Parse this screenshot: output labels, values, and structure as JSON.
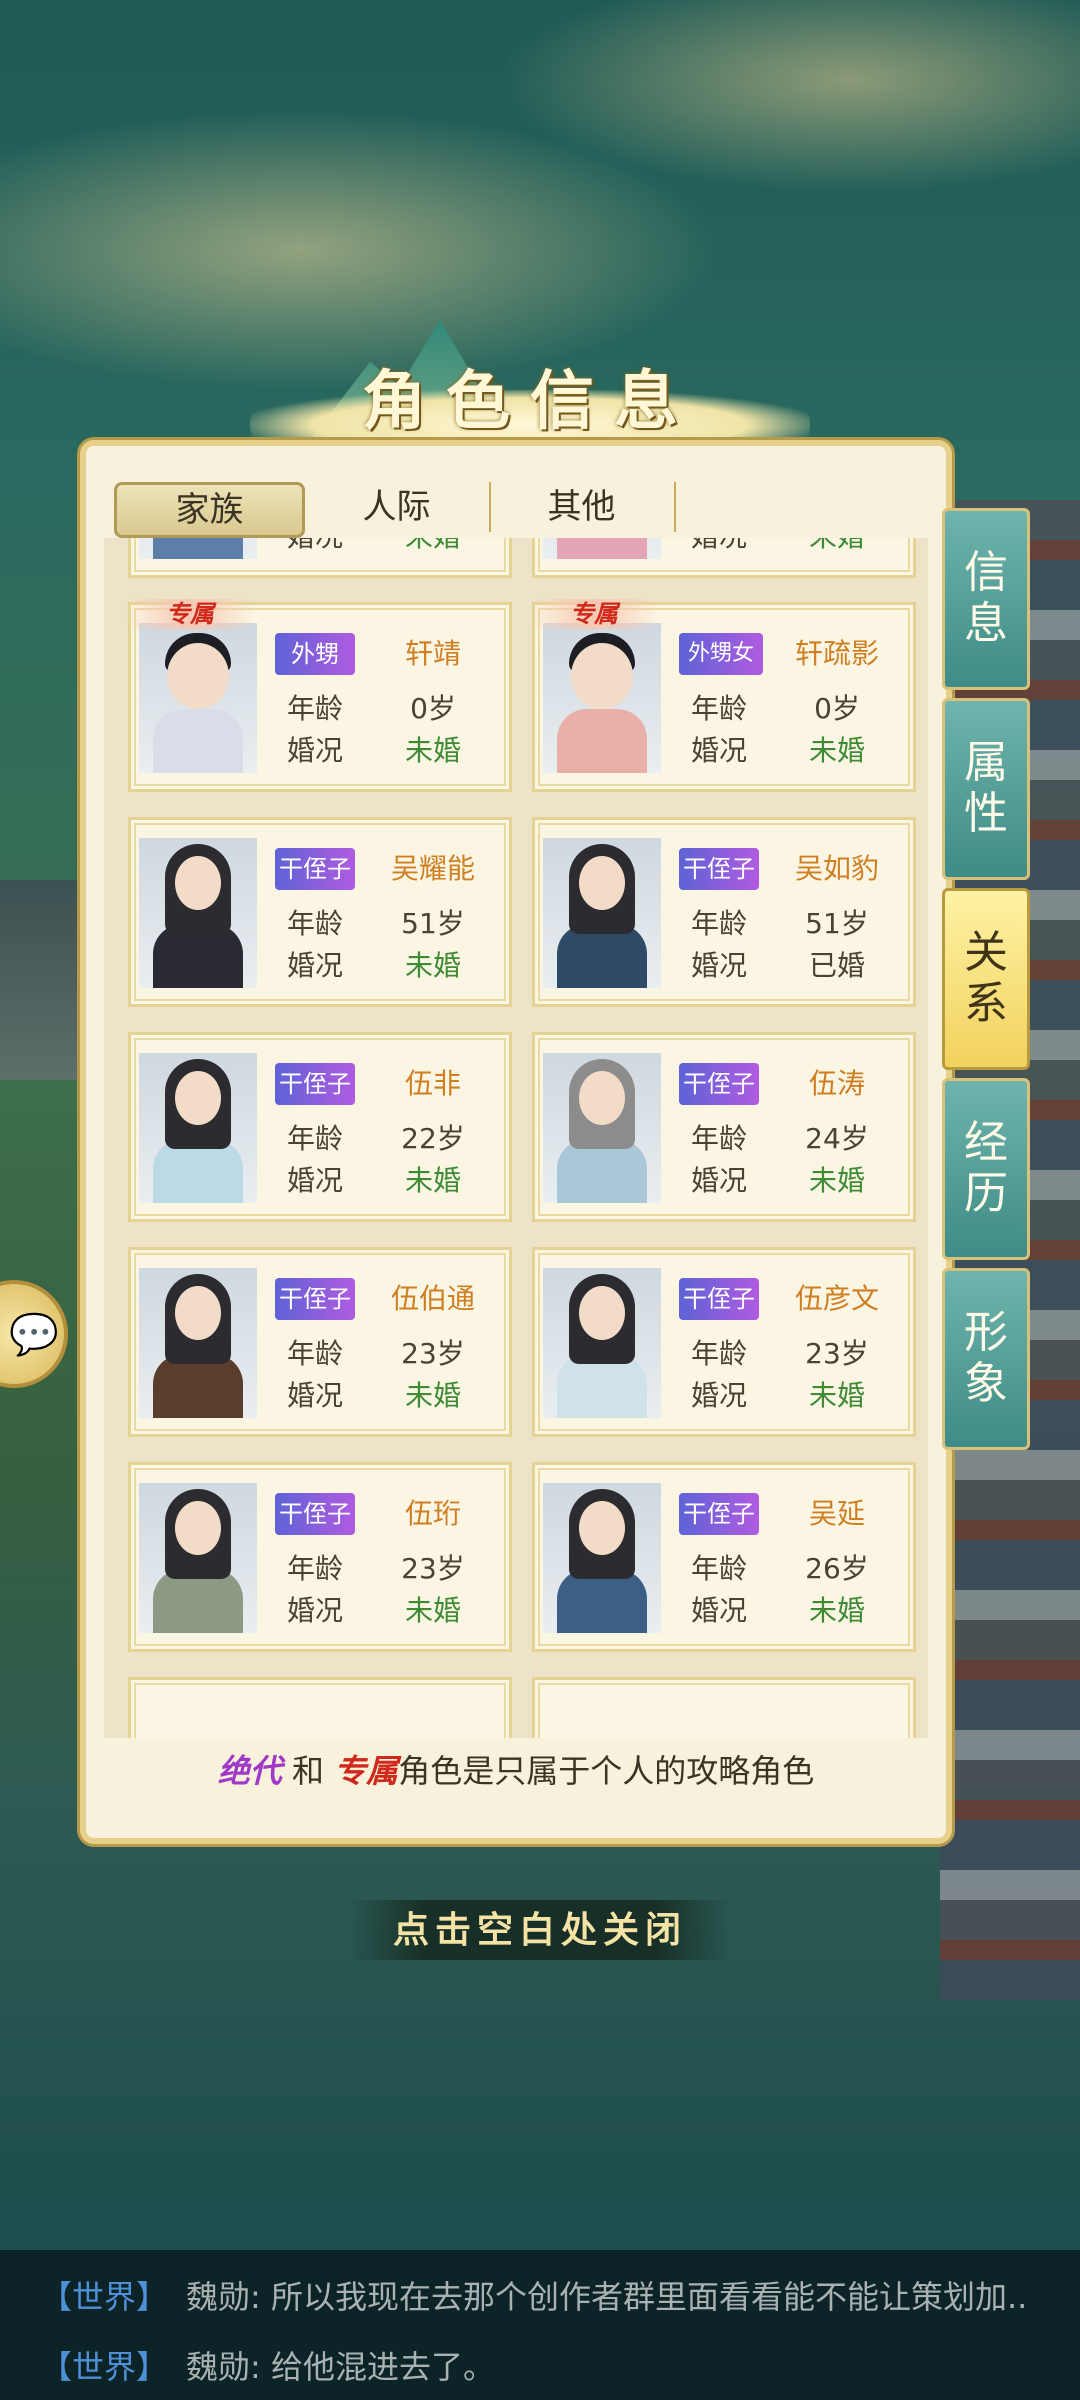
{
  "title": "角色信息",
  "tabs": [
    {
      "label": "家族",
      "active": true
    },
    {
      "label": "人际",
      "active": false
    },
    {
      "label": "其他",
      "active": false
    }
  ],
  "side_tabs": [
    {
      "label": "信息",
      "active": false
    },
    {
      "label": "属性",
      "active": false
    },
    {
      "label": "关系",
      "active": true
    },
    {
      "label": "经历",
      "active": false
    },
    {
      "label": "形象",
      "active": false
    }
  ],
  "labels": {
    "age": "年龄",
    "marital": "婚况"
  },
  "cards": [
    {
      "relation": "",
      "name": "",
      "age": "",
      "marital": "未婚",
      "exclusive": false,
      "partial": true
    },
    {
      "relation": "",
      "name": "",
      "age": "",
      "marital": "未婚",
      "exclusive": false,
      "partial": true
    },
    {
      "relation": "外甥",
      "name": "轩靖",
      "age": "0岁",
      "marital": "未婚",
      "exclusive": true,
      "exclusive_label": "专属"
    },
    {
      "relation": "外甥女",
      "name": "轩疏影",
      "age": "0岁",
      "marital": "未婚",
      "exclusive": true,
      "exclusive_label": "专属"
    },
    {
      "relation": "干侄子",
      "name": "吴耀能",
      "age": "51岁",
      "marital": "未婚"
    },
    {
      "relation": "干侄子",
      "name": "吴如豹",
      "age": "51岁",
      "marital": "已婚"
    },
    {
      "relation": "干侄子",
      "name": "伍非",
      "age": "22岁",
      "marital": "未婚"
    },
    {
      "relation": "干侄子",
      "name": "伍涛",
      "age": "24岁",
      "marital": "未婚"
    },
    {
      "relation": "干侄子",
      "name": "伍伯通",
      "age": "23岁",
      "marital": "未婚"
    },
    {
      "relation": "干侄子",
      "name": "伍彦文",
      "age": "23岁",
      "marital": "未婚"
    },
    {
      "relation": "干侄子",
      "name": "伍珩",
      "age": "23岁",
      "marital": "未婚"
    },
    {
      "relation": "干侄子",
      "name": "吴延",
      "age": "26岁",
      "marital": "未婚"
    }
  ],
  "footer_note": {
    "kw1": "绝代",
    "mid": " 和 ",
    "kw2": "专属",
    "rest": "角色是只属于个人的攻略角色"
  },
  "close_hint": "点击空白处关闭",
  "chat": [
    {
      "channel": "【世界】",
      "sender": "魏勋:",
      "text": " 所以我现在去那个创作者群里面看看能不能让策划加.."
    },
    {
      "channel": "【世界】",
      "sender": "魏勋:",
      "text": " 给他混进去了。"
    }
  ],
  "colors": {
    "single": "#3f8a34",
    "married": "#4a4233",
    "name": "#cf7f22",
    "relation_badge": "#7b5ee0"
  }
}
